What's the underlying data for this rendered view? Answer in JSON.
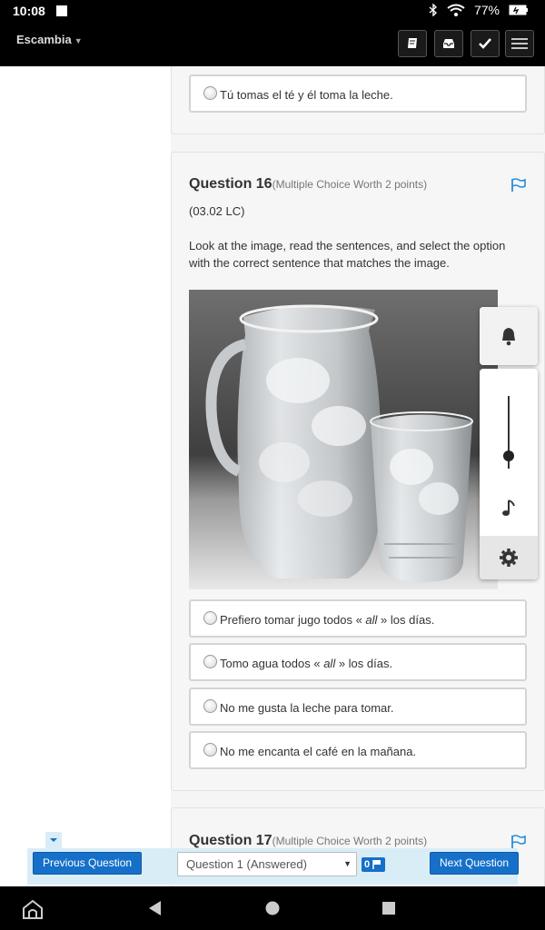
{
  "status_bar": {
    "time": "10:08",
    "battery": "77%"
  },
  "header": {
    "school": "Escambia",
    "buttons": [
      "book-icon",
      "inbox-icon",
      "check-icon",
      "menu-icon"
    ]
  },
  "prev_question": {
    "last_option": "Tú tomas el té y él toma la leche."
  },
  "question16": {
    "title": "Question 16",
    "worth": "(Multiple Choice Worth 2 points)",
    "code": "(03.02 LC)",
    "text": "Look at the image, read the sentences, and select the option with the correct sentence that matches the image.",
    "image_alt": "glass pitcher and glass of ice water",
    "options": [
      {
        "pre": "Prefiero tomar jugo todos « ",
        "em": "all",
        "post": " » los días."
      },
      {
        "pre": "Tomo agua todos « ",
        "em": "all",
        "post": " » los días."
      },
      {
        "pre": "No me gusta la leche para tomar.",
        "em": "",
        "post": ""
      },
      {
        "pre": "No me encanta el café en la mañana.",
        "em": "",
        "post": ""
      }
    ]
  },
  "question17": {
    "title": "Question 17",
    "worth": "(Multiple Choice Worth 2 points)"
  },
  "quiz_nav": {
    "previous_label": "Previous Question",
    "next_label": "Next Question",
    "selected_question": "Question 1 (Answered)",
    "flag_count": "0"
  },
  "colors": {
    "accent": "#1670c9",
    "flag": "#2a8fd8",
    "nav_bg": "#d9edf7"
  }
}
